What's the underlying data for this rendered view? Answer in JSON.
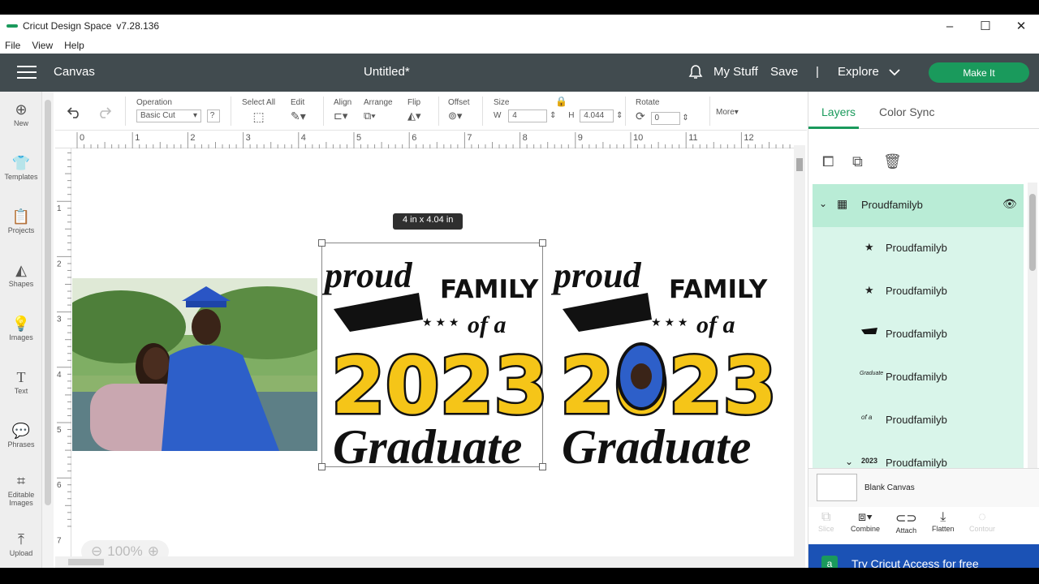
{
  "window": {
    "title": "Cricut Design Space",
    "version": "v7.28.136",
    "minimize": "–",
    "maximize": "☐",
    "close": "✕"
  },
  "menu": [
    "File",
    "View",
    "Help"
  ],
  "header": {
    "canvas": "Canvas",
    "doc_title": "Untitled*",
    "my_stuff": "My Stuff",
    "save": "Save",
    "divider": "|",
    "explore": "Explore",
    "make_it": "Make It"
  },
  "toolbar": {
    "operation_label": "Operation",
    "operation_value": "Basic Cut",
    "help": "?",
    "select_all": "Select All",
    "edit": "Edit",
    "align": "Align",
    "arrange": "Arrange",
    "flip": "Flip",
    "offset": "Offset",
    "size": "Size",
    "w_label": "W",
    "w_value": "4",
    "h_label": "H",
    "h_value": "4.044",
    "rotate": "Rotate",
    "rotate_value": "0",
    "more": "More"
  },
  "leftbar": [
    "New",
    "Templates",
    "Projects",
    "Shapes",
    "Images",
    "Text",
    "Phrases",
    "Editable Images",
    "Upload"
  ],
  "ruler_h": [
    "0",
    "1",
    "2",
    "3",
    "4",
    "5",
    "6",
    "7",
    "8",
    "9",
    "10",
    "11",
    "12"
  ],
  "ruler_v": [
    "1",
    "2",
    "3",
    "4",
    "5",
    "6",
    "7"
  ],
  "canvas": {
    "size_tooltip": "4  in x 4.04  in",
    "zoom": "100%",
    "design_text": {
      "proud": "proud",
      "family": "FAMILY",
      "of_a": "of a",
      "year": "2023",
      "graduate": "Graduate"
    }
  },
  "right_panel": {
    "tabs": [
      "Layers",
      "Color Sync"
    ],
    "layers": [
      {
        "name": "Proudfamilyb",
        "thumb": "group"
      },
      {
        "name": "Proudfamilyb",
        "thumb": "★"
      },
      {
        "name": "Proudfamilyb",
        "thumb": "★"
      },
      {
        "name": "Proudfamilyb",
        "thumb": "cap"
      },
      {
        "name": "Proudfamilyb",
        "thumb": "script"
      },
      {
        "name": "Proudfamilyb",
        "thumb": "of a"
      },
      {
        "name": "Proudfamilyb",
        "thumb": "2023"
      }
    ],
    "blank_canvas": "Blank Canvas",
    "actions": [
      "Slice",
      "Combine",
      "Attach",
      "Flatten",
      "Contour"
    ],
    "promo": "Try Cricut Access for free"
  },
  "colors": {
    "header": "#414b4f",
    "green": "#1a9a5c",
    "layer_bg": "#d9f5ea",
    "promo": "#1b52b5",
    "yellow": "#f5c518"
  }
}
